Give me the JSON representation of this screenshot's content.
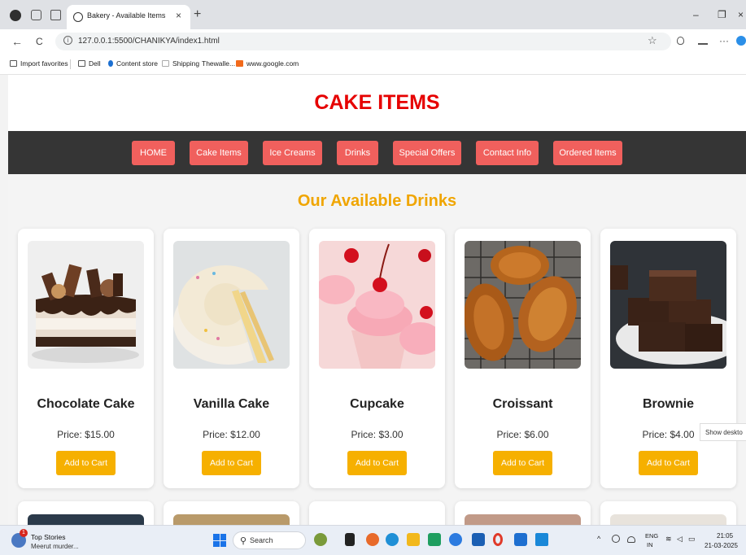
{
  "browser": {
    "tab_title": "Bakery - Available Items",
    "tab_close": "×",
    "new_tab": "+",
    "url": "127.0.0.1:5500/CHANIKYA/index1.html",
    "minimize": "–",
    "restore": "❐",
    "close": "×",
    "back": "←",
    "reload": "C",
    "star": "☆",
    "more": "···",
    "bookmarks": [
      "Import favorites",
      "Dell",
      "Content store",
      "Shipping",
      "Thewalle...",
      "www.google.com"
    ]
  },
  "site": {
    "title": "CAKE ITEMS",
    "nav": [
      "HOME",
      "Cake Items",
      "Ice Creams",
      "Drinks",
      "Special Offers",
      "Contact Info",
      "Ordered Items"
    ],
    "section_title": "Our Available Drinks",
    "add_to_cart_label": "Add to Cart",
    "products": [
      {
        "name": "Chocolate Cake",
        "price": "Price: $15.00"
      },
      {
        "name": "Vanilla Cake",
        "price": "Price: $12.00"
      },
      {
        "name": "Cupcake",
        "price": "Price: $3.00"
      },
      {
        "name": "Croissant",
        "price": "Price: $6.00"
      },
      {
        "name": "Brownie",
        "price": "Price: $4.00"
      }
    ]
  },
  "overlay": {
    "show_desktop": "Show deskto"
  },
  "taskbar": {
    "news_title": "Top Stories",
    "news_sub": "Meerut murder...",
    "news_badge": "1",
    "search": "Search",
    "lang1": "ENG",
    "lang2": "IN",
    "time": "21:05",
    "date": "21-03-2025"
  },
  "colors": {
    "title_red": "#e60000",
    "nav_bg": "#353535",
    "nav_button": "#f0605d",
    "section_title": "#f0a500",
    "cart_button": "#f6b000"
  }
}
